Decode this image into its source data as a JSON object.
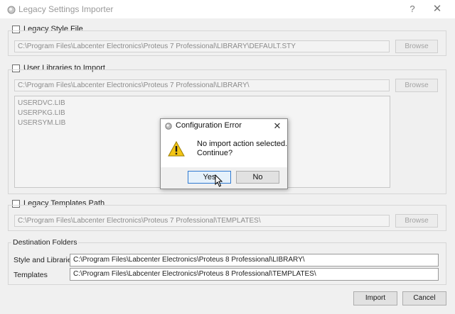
{
  "window": {
    "title": "Legacy Settings Importer",
    "help_glyph": "?",
    "close_glyph": "✕"
  },
  "legacy_style": {
    "label": "Legacy Style File",
    "path": "C:\\Program Files\\Labcenter Electronics\\Proteus 7 Professional\\LIBRARY\\DEFAULT.STY",
    "browse": "Browse"
  },
  "user_libraries": {
    "label": "User Libraries to Import",
    "path": "C:\\Program Files\\Labcenter Electronics\\Proteus 7 Professional\\LIBRARY\\",
    "browse": "Browse",
    "items": [
      "USERDVC.LIB",
      "USERPKG.LIB",
      "USERSYM.LIB"
    ]
  },
  "legacy_templates": {
    "label": "Legacy Templates Path",
    "path": "C:\\Program Files\\Labcenter Electronics\\Proteus 7 Professional\\TEMPLATES\\",
    "browse": "Browse"
  },
  "destination": {
    "title": "Destination Folders",
    "style_label": "Style and Libraries",
    "style_path": "C:\\Program Files\\Labcenter Electronics\\Proteus 8 Professional\\LIBRARY\\",
    "templates_label": "Templates",
    "templates_path": "C:\\Program Files\\Labcenter Electronics\\Proteus 8 Professional\\TEMPLATES\\"
  },
  "footer": {
    "import": "Import",
    "cancel": "Cancel"
  },
  "dialog": {
    "title": "Configuration Error",
    "close_glyph": "✕",
    "message_line1": "No import action selected.",
    "message_line2": "Continue?",
    "yes": "Yes",
    "no": "No",
    "icon": "warning-icon"
  }
}
